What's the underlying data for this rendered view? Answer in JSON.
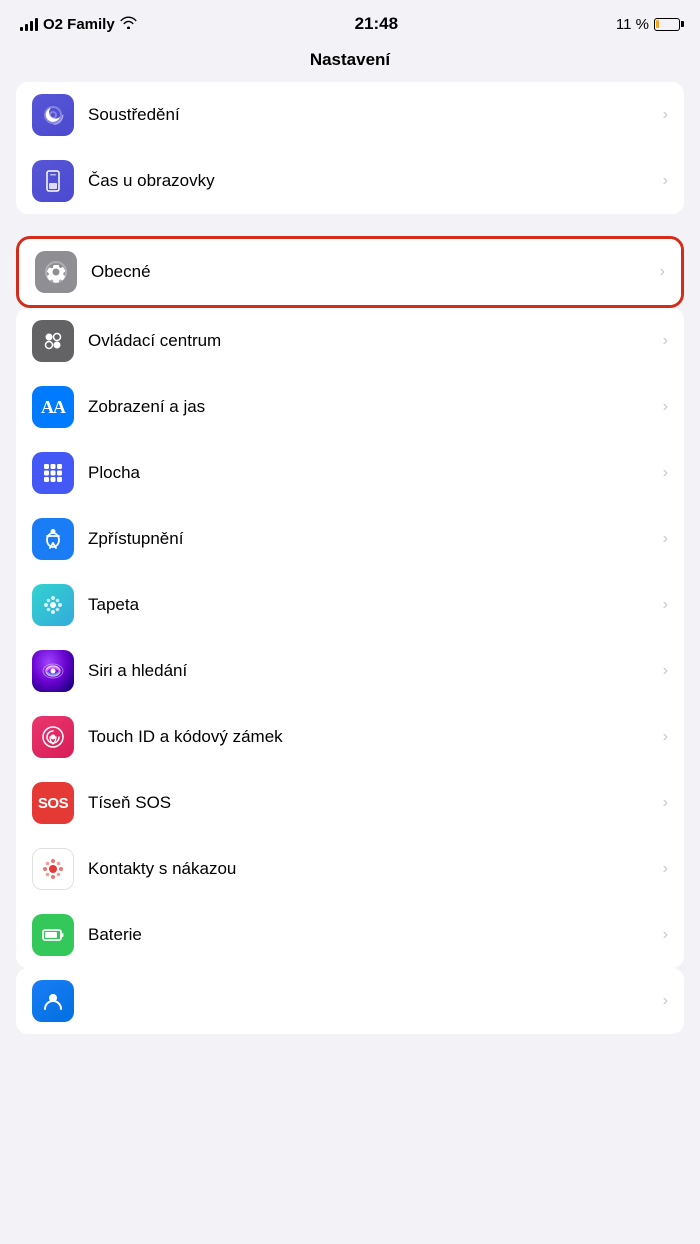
{
  "statusBar": {
    "carrier": "O2 Family",
    "time": "21:48",
    "battery": "11 %"
  },
  "pageTitle": "Nastavení",
  "groups": [
    {
      "id": "group1",
      "items": [
        {
          "id": "soustredeni",
          "label": "Soustředění",
          "iconType": "purple",
          "iconSymbol": "moon"
        },
        {
          "id": "cas-u-obrazovky",
          "label": "Čas u obrazovky",
          "iconType": "purple2",
          "iconSymbol": "hourglass"
        }
      ]
    },
    {
      "id": "group2",
      "items": [
        {
          "id": "obecne",
          "label": "Obecné",
          "iconType": "gray",
          "iconSymbol": "gear",
          "highlighted": true
        },
        {
          "id": "ovladaci-centrum",
          "label": "Ovládací centrum",
          "iconType": "dark-gray",
          "iconSymbol": "sliders"
        },
        {
          "id": "zobrazeni-a-jas",
          "label": "Zobrazení a jas",
          "iconType": "blue",
          "iconSymbol": "AA"
        },
        {
          "id": "plocha",
          "label": "Plocha",
          "iconType": "indigo",
          "iconSymbol": "grid"
        },
        {
          "id": "zpristupneni",
          "label": "Zpřístupnění",
          "iconType": "blue",
          "iconSymbol": "accessibility"
        },
        {
          "id": "tapeta",
          "label": "Tapeta",
          "iconType": "cyan",
          "iconSymbol": "flower"
        },
        {
          "id": "siri",
          "label": "Siri a hledání",
          "iconType": "siri",
          "iconSymbol": "siri"
        },
        {
          "id": "touch-id",
          "label": "Touch ID a kódový zámek",
          "iconType": "pink",
          "iconSymbol": "fingerprint"
        },
        {
          "id": "tisen-sos",
          "label": "Tíseň SOS",
          "iconType": "red",
          "iconSymbol": "SOS"
        },
        {
          "id": "kontakty-s-nakazou",
          "label": "Kontakty s nákazou",
          "iconType": "covid",
          "iconSymbol": "covid"
        },
        {
          "id": "baterie",
          "label": "Baterie",
          "iconType": "green",
          "iconSymbol": "battery"
        }
      ]
    }
  ],
  "chevronLabel": "›"
}
